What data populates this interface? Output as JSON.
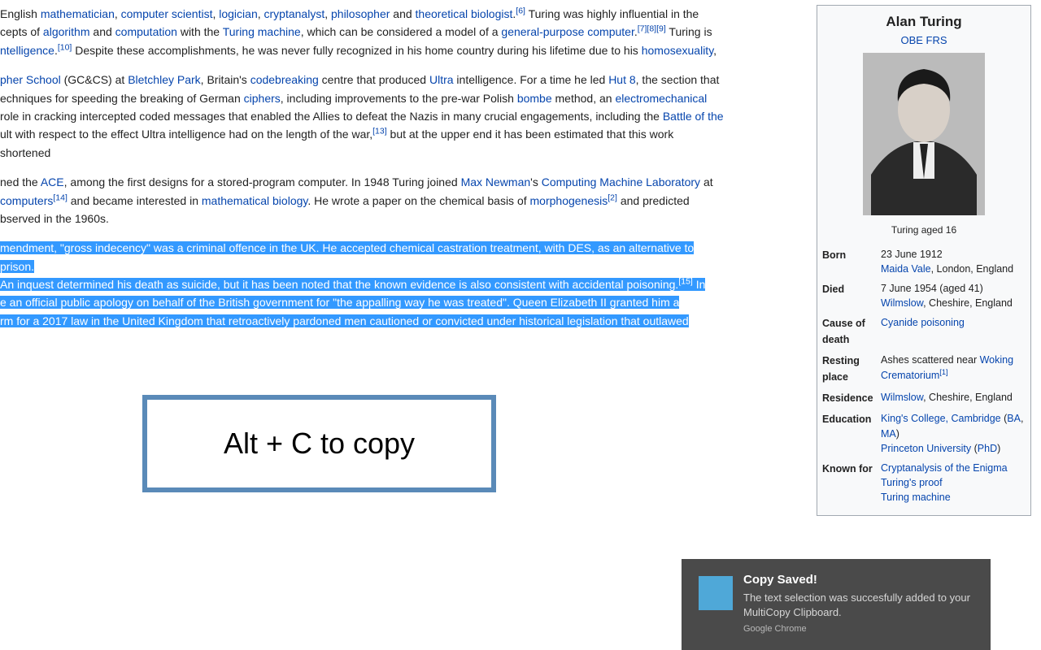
{
  "article": {
    "p1": {
      "t1": " English ",
      "l1": "mathematician",
      "t2": ", ",
      "l2": "computer scientist",
      "t3": ", ",
      "l3": "logician",
      "t4": ", ",
      "l4": "cryptanalyst",
      "t5": ", ",
      "l5": "philosopher",
      "t6": " and ",
      "l6": "theoretical biologist",
      "t7": ".",
      "s1": "[6]",
      "t8": " Turing was highly influential in the ",
      "t9": "cepts of ",
      "l7": "algorithm",
      "t10": " and ",
      "l8": "computation",
      "t11": " with the ",
      "l9": "Turing machine",
      "t12": ", which can be considered a model of a ",
      "l10": "general-purpose computer",
      "t13": ".",
      "s2": "[7]",
      "s3": "[8]",
      "s4": "[9]",
      "t14": " Turing is ",
      "l11": "ntelligence",
      "t15": ".",
      "s5": "[10]",
      "t16": " Despite these accomplishments, he was never fully recognized in his home country during his lifetime due to his ",
      "l12": "homosexuality",
      "t17": ","
    },
    "p2": {
      "l1": "pher School",
      "t1": " (GC&CS) at ",
      "l2": "Bletchley Park",
      "t2": ", Britain's ",
      "l3": "codebreaking",
      "t3": " centre that produced ",
      "l4": "Ultra",
      "t4": " intelligence. For a time he led ",
      "l5": "Hut 8",
      "t5": ", the section that ",
      "t6": "echniques for speeding the breaking of German ",
      "l6": "ciphers",
      "t7": ", including improvements to the pre-war Polish ",
      "l7": "bombe",
      "t8": " method, an ",
      "l8": "electromechanical",
      "t9": " role in cracking intercepted coded messages that enabled the Allies to defeat the Nazis in many crucial engagements, including the ",
      "l9": "Battle of the",
      "t10": "ult with respect to the effect Ultra intelligence had on the length of the war,",
      "s1": "[13]",
      "t11": " but at the upper end it has been estimated that this work shortened"
    },
    "p3": {
      "t1": "ned the ",
      "l1": "ACE",
      "t2": ", among the first designs for a stored-program computer. In 1948 Turing joined ",
      "l2": "Max Newman",
      "t3": "'s ",
      "l3": "Computing Machine Laboratory",
      "t4": " at ",
      "l4": "computers",
      "s1": "[14]",
      "t5": " and became interested in ",
      "l5": "mathematical biology",
      "t6": ". He wrote a paper on the chemical basis of ",
      "l6": "morphogenesis",
      "s2": "[2]",
      "t7": " and predicted ",
      "t8": "bserved in the 1960s."
    },
    "p4": {
      "t1": "mendment, \"gross indecency\" was a criminal offence in the UK. He accepted chemical castration treatment, with DES, as an alternative to prison.",
      "t2": "An inquest determined his death as suicide, but it has been noted that the known evidence is also consistent with accidental poisoning.",
      "s1": "[15]",
      "t3": " In ",
      "t4": "e an official public apology on behalf of the British government for \"the appalling way he was treated\". Queen Elizabeth II granted him a ",
      "t5": "rm for a 2017 law in the United Kingdom that retroactively pardoned men cautioned or convicted under historical legislation that outlawed"
    }
  },
  "overlay": {
    "text": "Alt + C to copy"
  },
  "infobox": {
    "title": "Alan Turing",
    "honors": "OBE FRS",
    "caption": "Turing aged 16",
    "rows": {
      "born_label": "Born",
      "born_val": "23 June 1912",
      "born_link": "Maida Vale",
      "born_rest": ", London, England",
      "died_label": "Died",
      "died_val": "7 June 1954 (aged 41)",
      "died_link": "Wilmslow",
      "died_rest": ", Cheshire, England",
      "cod_label": "Cause of death",
      "cod_link": "Cyanide poisoning",
      "rest_label": "Resting place",
      "rest_pre": "Ashes scattered near ",
      "rest_l1": "Woking",
      "rest_l2": "Crematorium",
      "rest_sup": "[1]",
      "res_label": "Residence",
      "res_link": "Wilmslow",
      "res_rest": ", Cheshire, England",
      "edu_label": "Education",
      "edu_l1": "King's College, Cambridge",
      "edu_p1": " (",
      "edu_l2": "BA",
      "edu_c1": ", ",
      "edu_l3": "MA",
      "edu_p2": ")",
      "edu_l4": "Princeton University",
      "edu_p3": " (",
      "edu_l5": "PhD",
      "edu_p4": ")",
      "known_label": "Known for",
      "known_l1": "Cryptanalysis of the Enigma",
      "known_l2": "Turing's proof",
      "known_l3": "Turing machine"
    }
  },
  "toast": {
    "title": "Copy Saved!",
    "message": "The text selection was succesfully added to your MultiCopy Clipboard.",
    "source": "Google Chrome"
  }
}
